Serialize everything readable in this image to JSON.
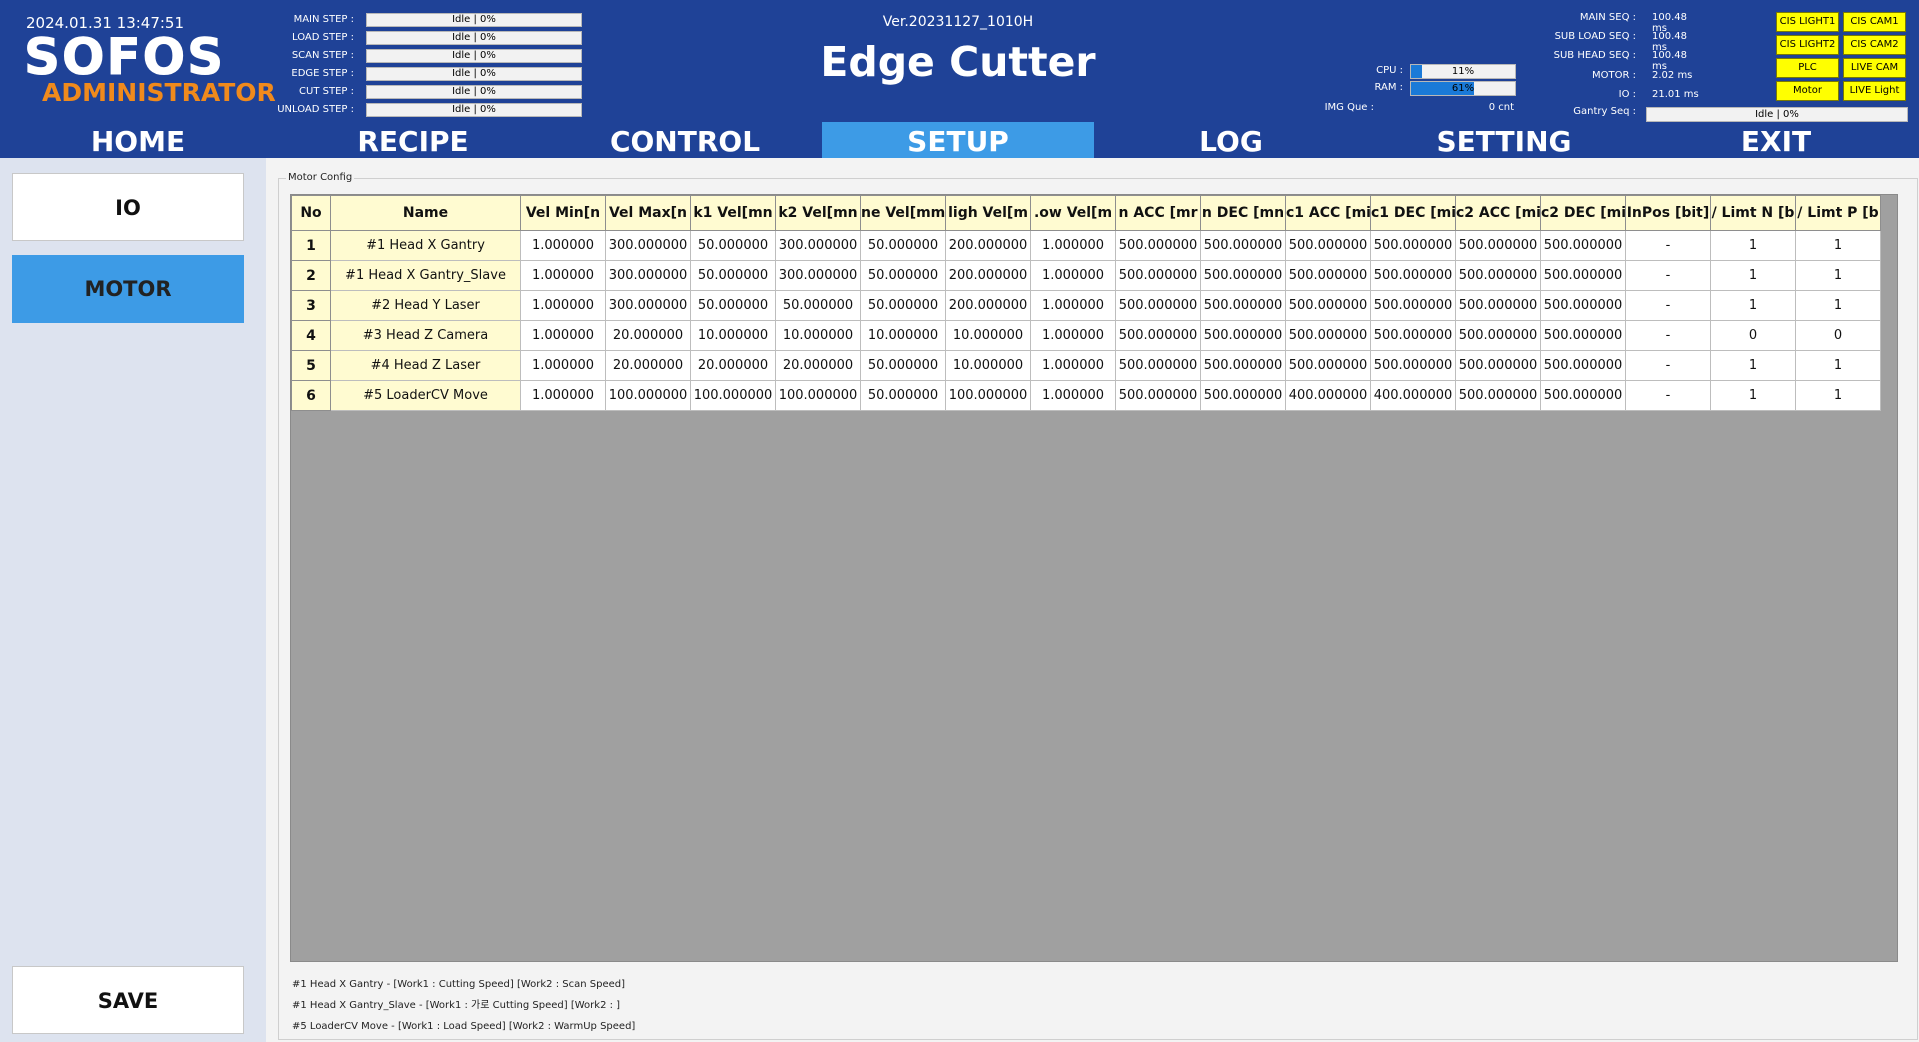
{
  "header": {
    "datetime": "2024.01.31 13:47:51",
    "logo": "SOFOS",
    "role": "ADMINISTRATOR",
    "version": "Ver.20231127_1010H",
    "title": "Edge Cutter",
    "steps": [
      {
        "label": "MAIN STEP :",
        "value": "Idle | 0%"
      },
      {
        "label": "LOAD STEP :",
        "value": "Idle | 0%"
      },
      {
        "label": "SCAN STEP :",
        "value": "Idle | 0%"
      },
      {
        "label": "EDGE STEP :",
        "value": "Idle | 0%"
      },
      {
        "label": "CUT STEP :",
        "value": "Idle | 0%"
      },
      {
        "label": "UNLOAD STEP :",
        "value": "Idle | 0%"
      }
    ],
    "resources": {
      "cpu_label": "CPU :",
      "cpu_value": "11%",
      "cpu_fraction": 0.11,
      "ram_label": "RAM :",
      "ram_value": "61%",
      "ram_fraction": 0.61,
      "imgque_label": "IMG Que :",
      "imgque_value": "0 cnt"
    },
    "sequences": [
      {
        "label": "MAIN SEQ :",
        "value": "100.48 ms"
      },
      {
        "label": "SUB LOAD SEQ :",
        "value": "100.48 ms"
      },
      {
        "label": "SUB HEAD SEQ :",
        "value": "100.48 ms"
      },
      {
        "label": "MOTOR :",
        "value": "2.02 ms"
      },
      {
        "label": "IO :",
        "value": "21.01 ms"
      }
    ],
    "gantry_label": "Gantry Seq :",
    "gantry_value": "Idle | 0%",
    "indicators": [
      "CIS LIGHT1",
      "CIS CAM1",
      "CIS LIGHT2",
      "CIS CAM2",
      "PLC",
      "LIVE CAM",
      "Motor",
      "LIVE Light"
    ],
    "indicator_color": "#ffff00"
  },
  "nav": {
    "tabs": [
      "HOME",
      "RECIPE",
      "CONTROL",
      "SETUP",
      "LOG",
      "SETTING",
      "EXIT"
    ],
    "active": "SETUP",
    "active_color": "#3d9be6"
  },
  "sidebar": {
    "io": "IO",
    "motor": "MOTOR",
    "save": "SAVE"
  },
  "main": {
    "group_label": "Motor Config",
    "columns": [
      "No",
      "Name",
      "Vel Min[n",
      "Vel Max[n",
      "k1 Vel[mn",
      "k2 Vel[mn",
      "ne Vel[mm",
      "ligh Vel[m",
      ".ow Vel[m",
      "n ACC [mr",
      "n DEC [mn",
      "c1 ACC [mi",
      "c1 DEC [mi",
      "c2 ACC [mi",
      "c2 DEC [mi",
      "InPos [bit]",
      "/ Limt N [b",
      "/ Limt P [b"
    ],
    "rows": [
      [
        "1",
        "#1 Head X Gantry",
        "1.000000",
        "300.000000",
        "50.000000",
        "300.000000",
        "50.000000",
        "200.000000",
        "1.000000",
        "500.000000",
        "500.000000",
        "500.000000",
        "500.000000",
        "500.000000",
        "500.000000",
        "-",
        "1",
        "1"
      ],
      [
        "2",
        "#1 Head X Gantry_Slave",
        "1.000000",
        "300.000000",
        "50.000000",
        "300.000000",
        "50.000000",
        "200.000000",
        "1.000000",
        "500.000000",
        "500.000000",
        "500.000000",
        "500.000000",
        "500.000000",
        "500.000000",
        "-",
        "1",
        "1"
      ],
      [
        "3",
        "#2 Head Y Laser",
        "1.000000",
        "300.000000",
        "50.000000",
        "50.000000",
        "50.000000",
        "200.000000",
        "1.000000",
        "500.000000",
        "500.000000",
        "500.000000",
        "500.000000",
        "500.000000",
        "500.000000",
        "-",
        "1",
        "1"
      ],
      [
        "4",
        "#3 Head Z Camera",
        "1.000000",
        "20.000000",
        "10.000000",
        "10.000000",
        "10.000000",
        "10.000000",
        "1.000000",
        "500.000000",
        "500.000000",
        "500.000000",
        "500.000000",
        "500.000000",
        "500.000000",
        "-",
        "0",
        "0"
      ],
      [
        "5",
        "#4 Head Z Laser",
        "1.000000",
        "20.000000",
        "20.000000",
        "20.000000",
        "50.000000",
        "10.000000",
        "1.000000",
        "500.000000",
        "500.000000",
        "500.000000",
        "500.000000",
        "500.000000",
        "500.000000",
        "-",
        "1",
        "1"
      ],
      [
        "6",
        "#5 LoaderCV Move",
        "1.000000",
        "100.000000",
        "100.000000",
        "100.000000",
        "50.000000",
        "100.000000",
        "1.000000",
        "500.000000",
        "500.000000",
        "400.000000",
        "400.000000",
        "500.000000",
        "500.000000",
        "-",
        "1",
        "1"
      ]
    ],
    "notes": [
      "#1 Head X Gantry - [Work1 : Cutting Speed] [Work2 : Scan Speed]",
      "#1 Head X Gantry_Slave - [Work1 : 가로 Cutting Speed] [Work2 : ]",
      "#5 LoaderCV Move - [Work1 : Load Speed] [Work2 : WarmUp Speed]"
    ]
  }
}
